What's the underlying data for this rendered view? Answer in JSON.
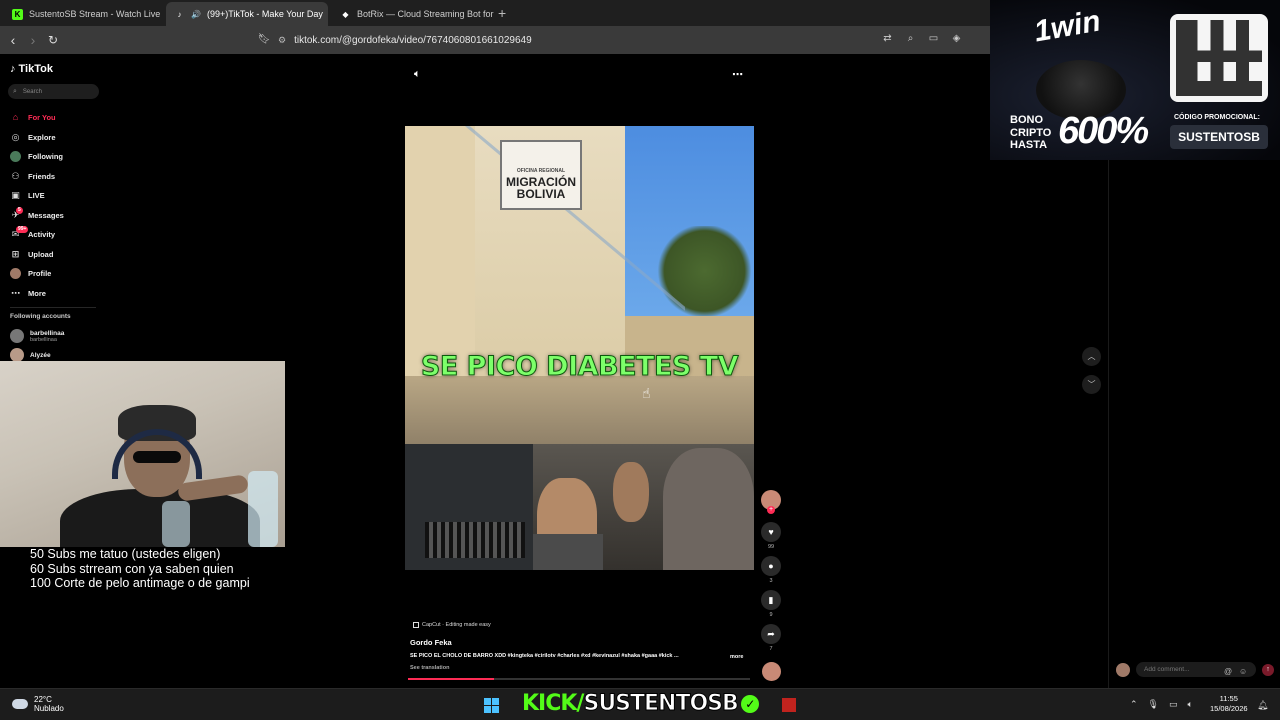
{
  "browser": {
    "tabs": [
      {
        "title": "SustentoSB Stream - Watch Live",
        "favicon": "kick-icon",
        "color": "#53fc18",
        "active": false
      },
      {
        "title": "(99+)TikTok - Make Your Day",
        "favicon": "tiktok-icon",
        "color": "#ffffff",
        "active": true
      },
      {
        "title": "BotRix — Cloud Streaming Bot for Tw",
        "favicon": "botrix-icon",
        "color": "#ffffff",
        "active": false
      }
    ],
    "new_tab": "+",
    "close_glyph": "✕",
    "url": "tiktok.com/@gordofeka/video/7674060801661029649"
  },
  "sidebar": {
    "logo": "TikTok",
    "search_placeholder": "Search",
    "items": [
      {
        "label": "For You",
        "icon": "home-icon",
        "active": true
      },
      {
        "label": "Explore",
        "icon": "compass-icon",
        "active": false
      },
      {
        "label": "Following",
        "icon": "following-icon",
        "active": false
      },
      {
        "label": "Friends",
        "icon": "friends-icon",
        "active": false
      },
      {
        "label": "LIVE",
        "icon": "live-icon",
        "active": false
      },
      {
        "label": "Messages",
        "icon": "messages-icon",
        "active": false,
        "badge": "5"
      },
      {
        "label": "Activity",
        "icon": "activity-icon",
        "active": false,
        "badge": "99+"
      },
      {
        "label": "Upload",
        "icon": "upload-icon",
        "active": false
      },
      {
        "label": "Profile",
        "icon": "profile-icon",
        "active": false
      },
      {
        "label": "More",
        "icon": "more-icon",
        "active": false
      }
    ],
    "following_title": "Following accounts",
    "accounts": [
      {
        "name": "barbellinaa",
        "handle": "barbellinaa"
      },
      {
        "name": "Alyzée",
        "handle": ""
      }
    ]
  },
  "stream_goals": [
    "50 Subs me tatuo (ustedes eligen)",
    "60 Subs strream con ya saben quien",
    "100 Corte de pelo antimage o de gampi"
  ],
  "video": {
    "sign_top": "OFICINA REGIONAL",
    "sign_main": "MIGRACIÓN BOLIVIA",
    "overlay_text": "SE PICO DIABETES TV",
    "likes": "99",
    "comments": "3",
    "saves": "9",
    "shares": "7",
    "progress_pct": 25
  },
  "caption": {
    "capcut": "CapCut · Editing made easy",
    "author": "Gordo Feka",
    "description": "SE PICO EL CHOLO DE BARRO XDD #kingteka #cirilotv #charles #xd #kevinazul #shaka #gaaa #kick ...",
    "more": "more",
    "see_translation": "See translation"
  },
  "comment_box": {
    "placeholder": "Add comment..."
  },
  "ad": {
    "brand": "1win",
    "bono": "BONO\nCRIPTO\nHASTA",
    "bono_lines": [
      "BONO",
      "CRIPTO",
      "HASTA"
    ],
    "percent": "600%",
    "codigo_label": "CÓDIGO PROMOCIONAL:",
    "code": "SUSTENTOSB"
  },
  "taskbar": {
    "temp": "22°C",
    "condition": "Nublado",
    "kick_prefix": "KICK/",
    "kick_channel": "SUSTENTOSB",
    "time": "11:55",
    "date": "15/08/2026"
  }
}
